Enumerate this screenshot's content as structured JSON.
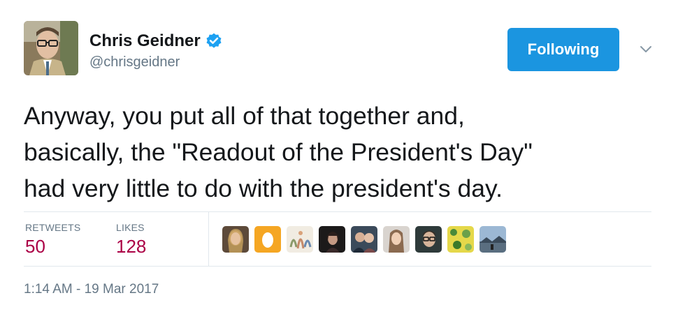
{
  "user": {
    "display_name": "Chris Geidner",
    "handle": "@chrisgeidner",
    "verified": true,
    "avatar_icon": "profile-photo"
  },
  "follow_button": {
    "label": "Following",
    "color": "#1b95e0"
  },
  "menu": {
    "icon": "chevron-down-icon"
  },
  "tweet": {
    "lines": [
      "Anyway, you put all of that together and,",
      "basically, the \"Readout of the President's Day\"",
      "had very little to do with the president's day."
    ]
  },
  "stats": {
    "retweets_label": "RETWEETS",
    "retweets_value": "50",
    "likes_label": "LIKES",
    "likes_value": "128",
    "value_color": "#ab0045"
  },
  "likers": [
    {
      "icon": "liker-avatar-woman-blonde"
    },
    {
      "icon": "liker-avatar-egg"
    },
    {
      "icon": "liker-avatar-illustration"
    },
    {
      "icon": "liker-avatar-dark"
    },
    {
      "icon": "liker-avatar-couple"
    },
    {
      "icon": "liker-avatar-woman-light"
    },
    {
      "icon": "liker-avatar-woman-glasses"
    },
    {
      "icon": "liker-avatar-yellow-pattern"
    },
    {
      "icon": "liker-avatar-landscape"
    }
  ],
  "timestamp": "1:14 AM - 19 Mar 2017"
}
